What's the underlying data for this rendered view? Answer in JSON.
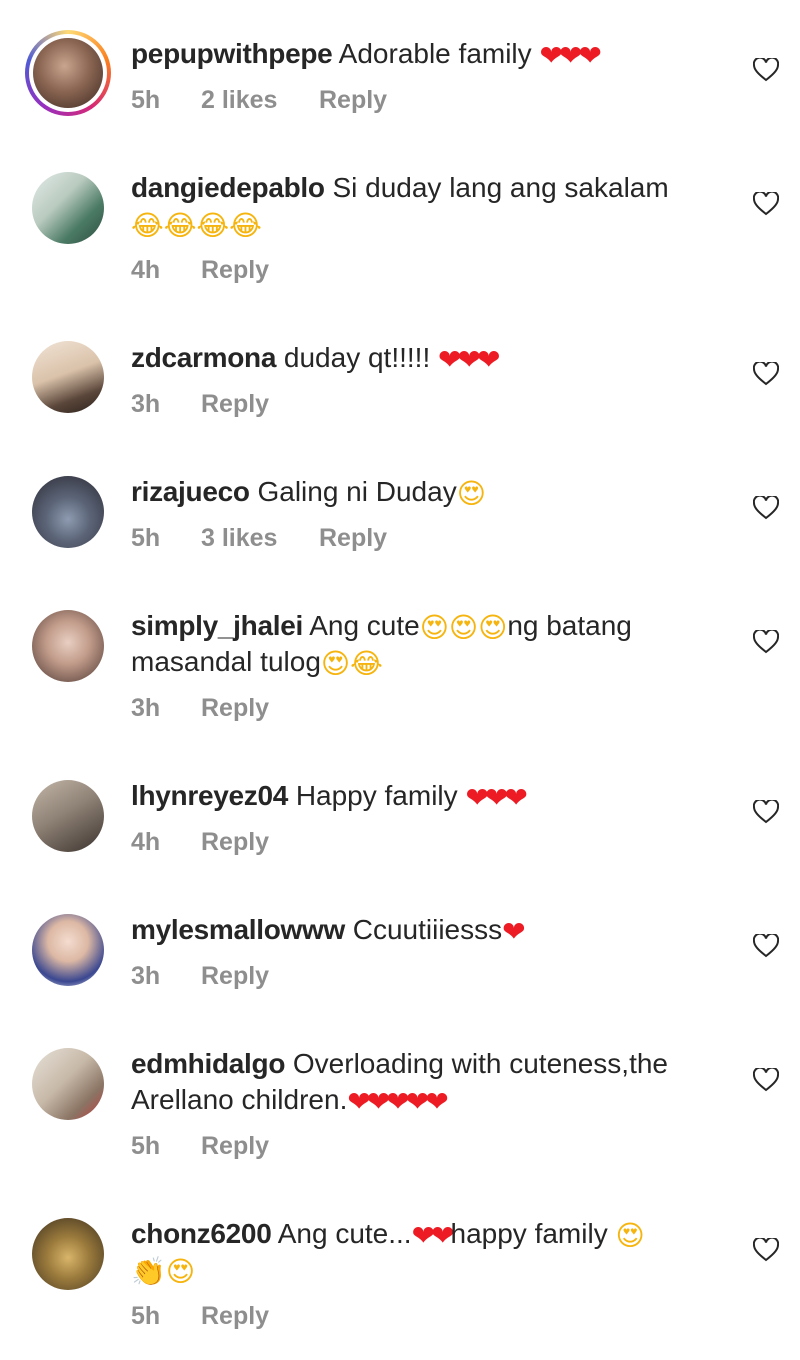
{
  "comments": [
    {
      "username": "pepupwithpepe",
      "text_line1": "Adorable family",
      "text_line2": "",
      "emojis_line1": [
        "heart",
        "heart",
        "heart"
      ],
      "emojis_line2": [],
      "time": "5h",
      "likes": "2 likes",
      "reply": "Reply",
      "avatar_colors": [
        "#b89480",
        "#5a3b2e"
      ],
      "story_ring": true
    },
    {
      "username": "dangiedepablo",
      "text_line1": "Si duday lang ang sakalam",
      "text_line2": "",
      "emojis_line1": [],
      "emojis_line2": [
        "laugh",
        "laugh",
        "laugh",
        "laugh"
      ],
      "time": "4h",
      "likes": "",
      "reply": "Reply",
      "avatar_colors": [
        "#c7d6c8",
        "#3a6f5a"
      ],
      "story_ring": false
    },
    {
      "username": "zdcarmona",
      "text_line1": "duday qt!!!!!",
      "text_line2": "",
      "emojis_line1": [
        "heart",
        "heart",
        "heart"
      ],
      "emojis_line2": [],
      "time": "3h",
      "likes": "",
      "reply": "Reply",
      "avatar_colors": [
        "#e6d3bf",
        "#6b5443"
      ],
      "story_ring": false
    },
    {
      "username": "rizajueco",
      "text_line1": "Galing ni Duday",
      "text_line2": "",
      "emojis_line1": [
        "heart-eyes"
      ],
      "emojis_line2": [],
      "time": "5h",
      "likes": "3 likes",
      "reply": "Reply",
      "avatar_colors": [
        "#6f7e93",
        "#2c2a34"
      ],
      "story_ring": false
    },
    {
      "username": "simply_jhalei",
      "text_line1": "Ang cute",
      "text_line1b": "ng batang",
      "text_line2": "masandal tulog",
      "emojis_line1": [
        "heart-eyes",
        "heart-eyes",
        "heart-eyes"
      ],
      "emojis_line2": [
        "heart-eyes",
        "laugh"
      ],
      "time": "3h",
      "likes": "",
      "reply": "Reply",
      "avatar_colors": [
        "#d8b8a8",
        "#5a4238"
      ],
      "story_ring": false
    },
    {
      "username": "lhynreyez04",
      "text_line1": "Happy family",
      "text_line2": "",
      "emojis_line1": [
        "heart",
        "heart",
        "heart"
      ],
      "emojis_line2": [],
      "time": "4h",
      "likes": "",
      "reply": "Reply",
      "avatar_colors": [
        "#a89a8c",
        "#3d3530"
      ],
      "story_ring": false
    },
    {
      "username": "mylesmallowww",
      "text_line1": "Ccuutiiiesss",
      "text_line2": "",
      "emojis_line1": [
        "heart"
      ],
      "emojis_line2": [],
      "time": "3h",
      "likes": "",
      "reply": "Reply",
      "avatar_colors": [
        "#f0dcd0",
        "#2e3e8c"
      ],
      "story_ring": false
    },
    {
      "username": "edmhidalgo",
      "text_line1": "Overloading with cuteness,the",
      "text_line2": "Arellano children.",
      "emojis_line1": [],
      "emojis_line2": [
        "heart",
        "heart",
        "heart",
        "heart",
        "heart"
      ],
      "time": "5h",
      "likes": "",
      "reply": "Reply",
      "avatar_colors": [
        "#d9d2c8",
        "#7a6a5c"
      ],
      "story_ring": false
    },
    {
      "username": "chonz6200",
      "text_line1": "Ang cute...",
      "text_line1b": "happy family",
      "text_line2": "",
      "emojis_line1": [
        "heart",
        "heart"
      ],
      "emojis_line1b": [
        "heart-eyes"
      ],
      "emojis_line2": [
        "clap",
        "heart-eyes"
      ],
      "time": "5h",
      "likes": "",
      "reply": "Reply",
      "avatar_colors": [
        "#b0905a",
        "#3a2e1e"
      ],
      "story_ring": false
    }
  ],
  "colors": {
    "text": "#262626",
    "meta": "#8e8e8e",
    "heart": "#ed1c24",
    "face": "#f6b40e"
  },
  "icons": {
    "like": "heart-outline-icon"
  }
}
